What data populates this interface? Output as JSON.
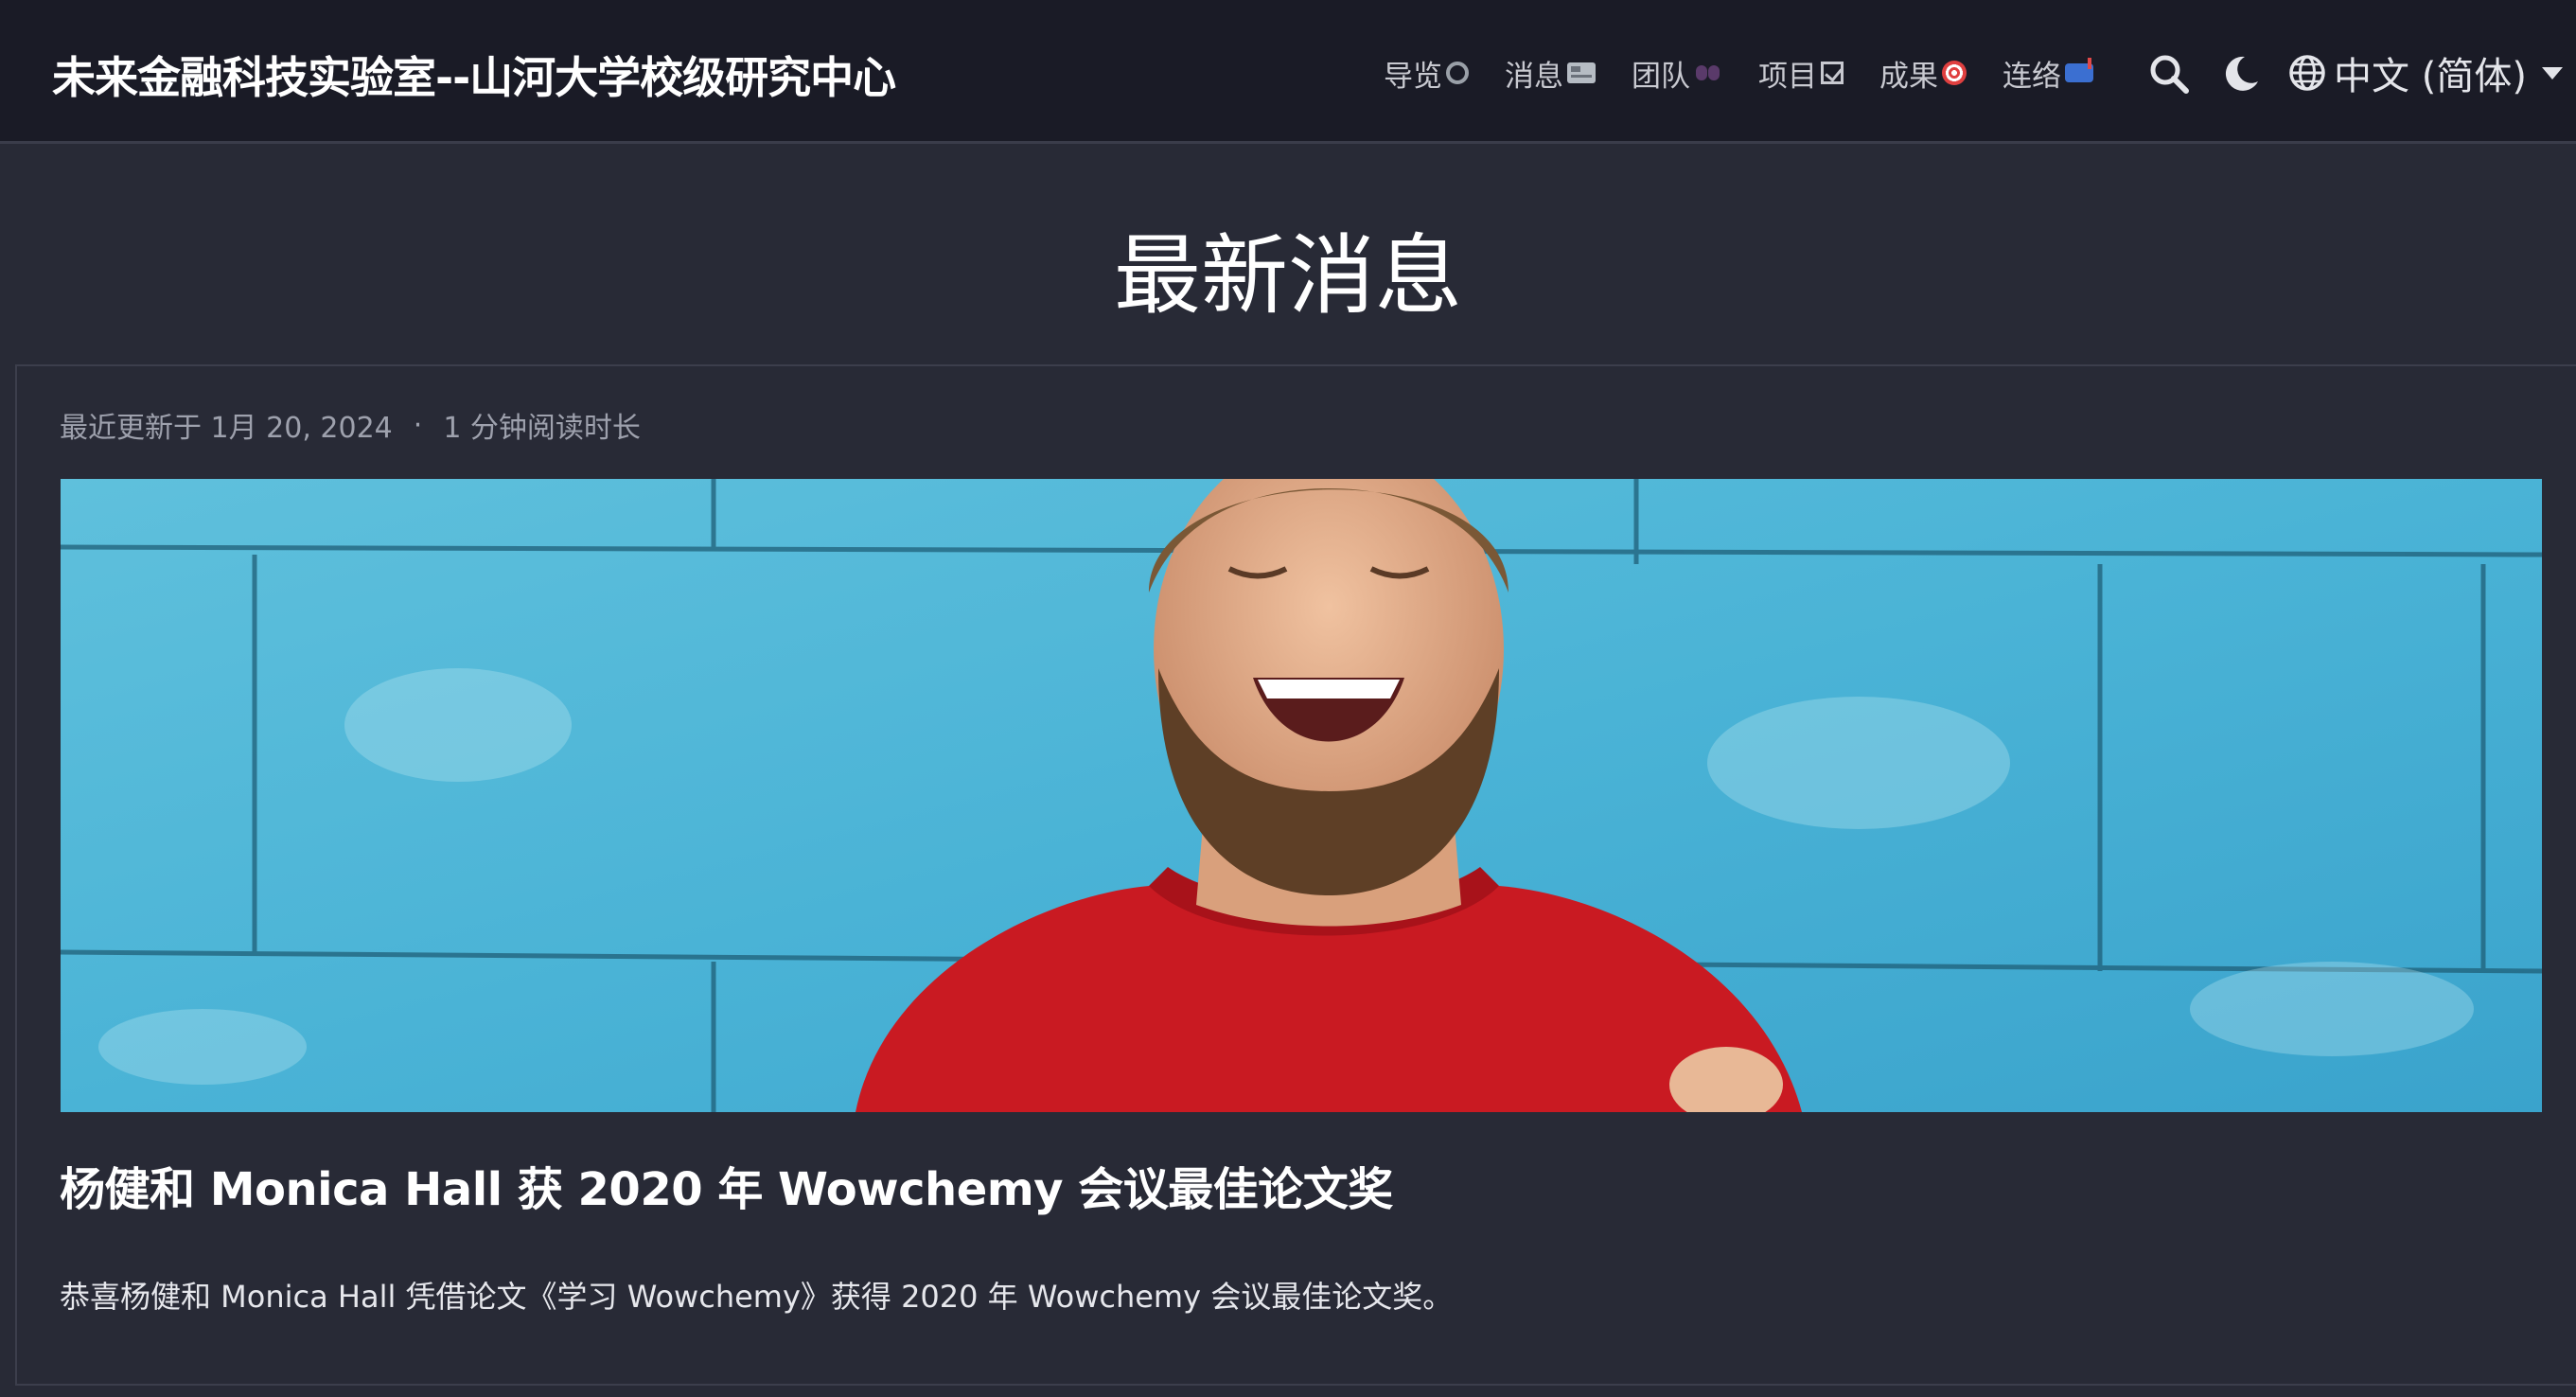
{
  "navbar": {
    "brand": "未来金融科技实验室--山河大学校级研究中心",
    "items": [
      {
        "label": "导览",
        "icon": "recycle-icon"
      },
      {
        "label": "消息",
        "icon": "newspaper-icon"
      },
      {
        "label": "团队",
        "icon": "hearts-icon"
      },
      {
        "label": "项目",
        "icon": "checkbox-icon"
      },
      {
        "label": "成果",
        "icon": "target-icon"
      },
      {
        "label": "连络",
        "icon": "mailbox-icon"
      }
    ],
    "search_icon": "search-icon",
    "theme_icon": "moon-icon",
    "language": "中文 (简体)",
    "language_icon": "globe-icon"
  },
  "page": {
    "title": "最新消息"
  },
  "article": {
    "updated": "最近更新于 1月 20, 2024",
    "separator": "·",
    "read_time": "1 分钟阅读时长",
    "image_alt": "laughing man in red sweater against blue brick wall",
    "title": "杨健和 Monica Hall 获 2020 年 Wowchemy 会议最佳论文奖",
    "summary": "恭喜杨健和 Monica Hall 凭借论文《学习 Wowchemy》获得 2020 年 Wowchemy 会议最佳论文奖。"
  },
  "colors": {
    "background": "#282a36",
    "navbar": "#1a1b26",
    "muted_text": "#9ea1ad",
    "card_border": "#3c3e4c"
  }
}
